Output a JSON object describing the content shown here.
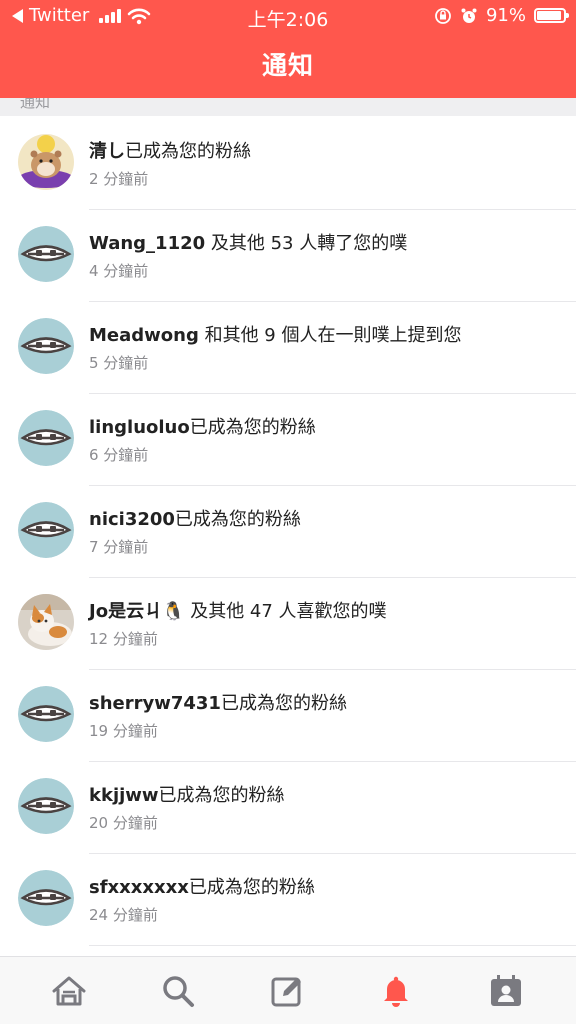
{
  "status_bar": {
    "back_app": "Twitter",
    "time": "上午2:06",
    "battery": "91%",
    "battery_level": 0.91
  },
  "header": {
    "title": "通知"
  },
  "section": {
    "label": "通知"
  },
  "notifications": [
    {
      "user": "清し",
      "text": "已成為您的粉絲",
      "time": "2 分鐘前",
      "avatar": "hamster-photo"
    },
    {
      "user": "Wang_1120",
      "text": " 及其他 53 人轉了您的噗",
      "time": "4 分鐘前",
      "avatar": "default-eye-avatar"
    },
    {
      "user": "Meadwong",
      "text": " 和其他 9 個人在一則噗上提到您",
      "time": "5 分鐘前",
      "avatar": "default-eye-avatar"
    },
    {
      "user": "lingluoluo",
      "text": "已成為您的粉絲",
      "time": "6 分鐘前",
      "avatar": "default-eye-avatar"
    },
    {
      "user": "nici3200",
      "text": "已成為您的粉絲",
      "time": "7 分鐘前",
      "avatar": "default-eye-avatar"
    },
    {
      "user": "Jo是云ㄐ🐧",
      "text": " 及其他 47 人喜歡您的噗",
      "time": "12 分鐘前",
      "avatar": "cat-photo"
    },
    {
      "user": "sherryw7431",
      "text": "已成為您的粉絲",
      "time": "19 分鐘前",
      "avatar": "default-eye-avatar"
    },
    {
      "user": "kkjjww",
      "text": "已成為您的粉絲",
      "time": "20 分鐘前",
      "avatar": "default-eye-avatar"
    },
    {
      "user": "sfxxxxxxx",
      "text": "已成為您的粉絲",
      "time": "24 分鐘前",
      "avatar": "default-eye-avatar"
    }
  ],
  "tabs": [
    {
      "icon": "home-icon",
      "active": false
    },
    {
      "icon": "search-icon",
      "active": false
    },
    {
      "icon": "compose-icon",
      "active": false
    },
    {
      "icon": "bell-icon",
      "active": true
    },
    {
      "icon": "profile-icon",
      "active": false
    }
  ],
  "colors": {
    "accent": "#ff574d",
    "avatar_bg": "#a9cfd6",
    "tab_icon": "#7a7a80"
  }
}
